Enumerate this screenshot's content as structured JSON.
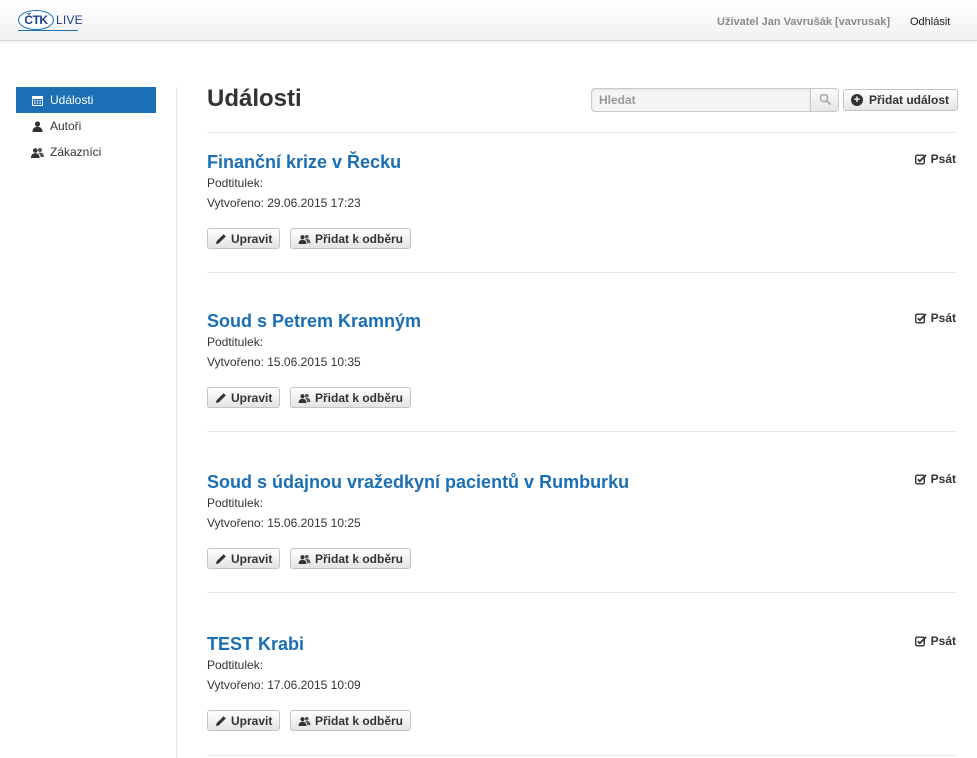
{
  "header": {
    "logo_text": "ČTK",
    "logo_suffix": "LIVE",
    "user_label": "Uživatel Jan Vavrušák [vavrusak]",
    "logout_label": "Odhlásit"
  },
  "sidebar": {
    "items": [
      {
        "label": "Události",
        "icon": "calendar-icon",
        "active": true
      },
      {
        "label": "Autoři",
        "icon": "user-icon",
        "active": false
      },
      {
        "label": "Zákazníci",
        "icon": "users-icon",
        "active": false
      }
    ]
  },
  "main": {
    "title": "Události",
    "search": {
      "placeholder": "Hledat"
    },
    "add_button_label": "Přidat událost",
    "events": [
      {
        "title": "Finanční krize v Řecku",
        "subtitle_label": "Podtitulek:",
        "created": "Vytvořeno: 29.06.2015 17:23",
        "edit_label": "Upravit",
        "subscribe_label": "Přidat k odběru",
        "write_label": "Psát"
      },
      {
        "title": "Soud s Petrem Kramným",
        "subtitle_label": "Podtitulek:",
        "created": "Vytvořeno: 15.06.2015 10:35",
        "edit_label": "Upravit",
        "subscribe_label": "Přidat k odběru",
        "write_label": "Psát"
      },
      {
        "title": "Soud s údajnou vražedkyní pacientů v Rumburku",
        "subtitle_label": "Podtitulek:",
        "created": "Vytvořeno: 15.06.2015 10:25",
        "edit_label": "Upravit",
        "subscribe_label": "Přidat k odběru",
        "write_label": "Psát"
      },
      {
        "title": "TEST Krabi",
        "subtitle_label": "Podtitulek:",
        "created": "Vytvořeno: 17.06.2015 10:09",
        "edit_label": "Upravit",
        "subscribe_label": "Přidat k odběru",
        "write_label": "Psát"
      }
    ]
  },
  "colors": {
    "accent": "#1a6fb5",
    "text": "#333333",
    "muted": "#8a8a8a"
  }
}
